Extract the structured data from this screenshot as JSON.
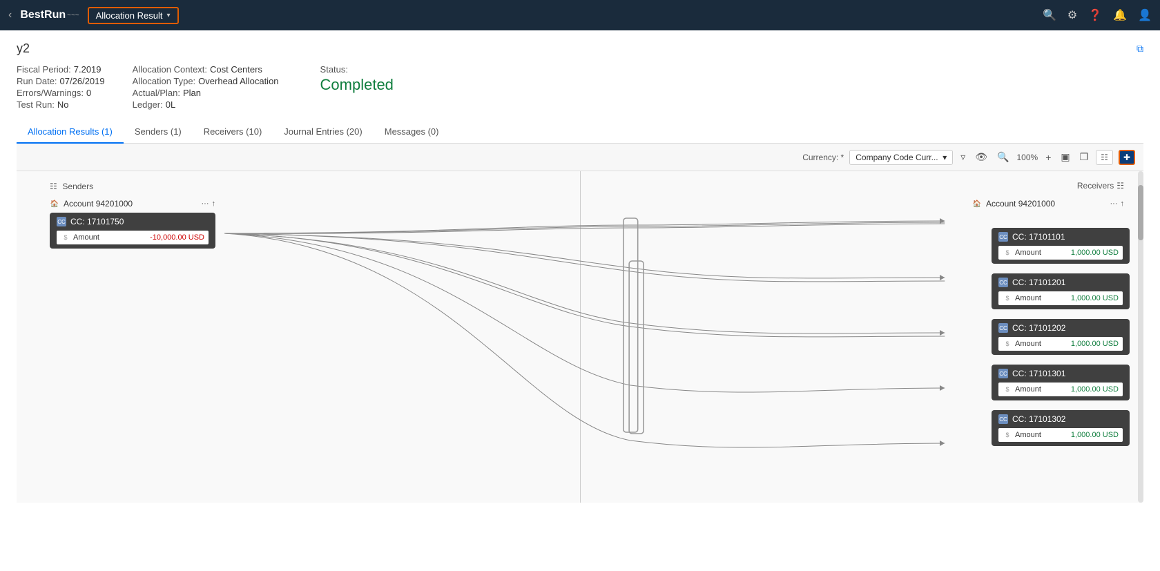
{
  "nav": {
    "back_label": "‹",
    "logo_best": "BestRun",
    "logo_tilde": "~",
    "app_title": "Allocation Result",
    "chevron": "▾",
    "icons": [
      "search",
      "settings",
      "help",
      "bell",
      "user"
    ]
  },
  "page": {
    "title": "y2",
    "link_icon": "⧉",
    "meta": {
      "fiscal_period_label": "Fiscal Period:",
      "fiscal_period_value": "7.2019",
      "allocation_context_label": "Allocation Context:",
      "allocation_context_value": "Cost Centers",
      "status_label": "Status:",
      "status_value": "Completed",
      "run_date_label": "Run Date:",
      "run_date_value": "07/26/2019",
      "allocation_type_label": "Allocation Type:",
      "allocation_type_value": "Overhead Allocation",
      "errors_label": "Errors/Warnings:",
      "errors_value": "0",
      "actual_plan_label": "Actual/Plan:",
      "actual_plan_value": "Plan",
      "test_run_label": "Test Run:",
      "test_run_value": "No",
      "ledger_label": "Ledger:",
      "ledger_value": "0L"
    }
  },
  "tabs": [
    {
      "label": "Allocation Results (1)",
      "active": true
    },
    {
      "label": "Senders (1)",
      "active": false
    },
    {
      "label": "Receivers (10)",
      "active": false
    },
    {
      "label": "Journal Entries (20)",
      "active": false
    },
    {
      "label": "Messages (0)",
      "active": false
    }
  ],
  "diagram": {
    "currency_label": "Currency: *",
    "currency_value": "Company Code Curr...",
    "zoom_value": "100%",
    "senders_label": "Senders",
    "receivers_label": "Receivers",
    "sender_account": "Account 94201000",
    "sender_cc": "CC: 17101750",
    "sender_amount_label": "Amount",
    "sender_amount_value": "-10,000.00 USD",
    "receiver_account": "Account 94201000",
    "receivers": [
      {
        "cc": "CC: 17101101",
        "amount_label": "Amount",
        "amount_value": "1,000.00 USD"
      },
      {
        "cc": "CC: 17101201",
        "amount_label": "Amount",
        "amount_value": "1,000.00 USD"
      },
      {
        "cc": "CC: 17101202",
        "amount_label": "Amount",
        "amount_value": "1,000.00 USD"
      },
      {
        "cc": "CC: 17101301",
        "amount_label": "Amount",
        "amount_value": "1,000.00 USD"
      },
      {
        "cc": "CC: 17101302",
        "amount_label": "Amount",
        "amount_value": "1,000.00 USD"
      }
    ]
  }
}
